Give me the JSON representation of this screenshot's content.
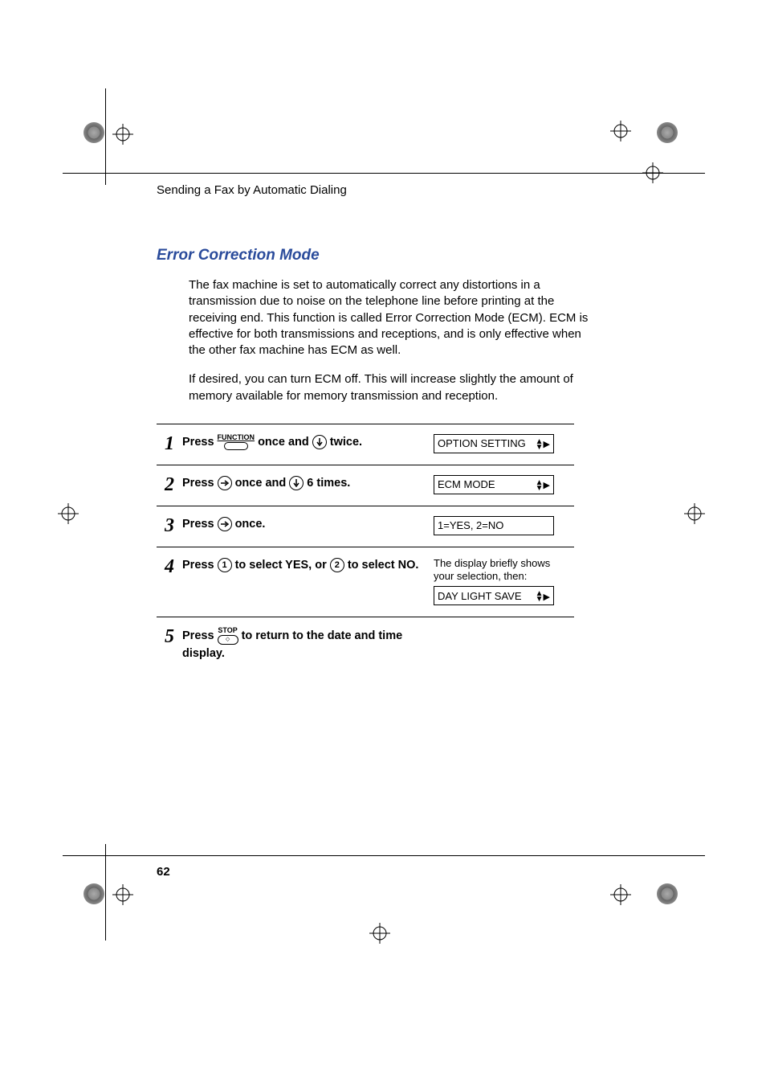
{
  "header": "Sending a Fax by Automatic Dialing",
  "section_title": "Error Correction Mode",
  "para1": "The fax machine is set to automatically correct any distortions in a transmission due to noise on the telephone line before printing at the receiving end. This function is called Error Correction Mode (ECM). ECM is effective for both transmissions and receptions, and is only effective when the other fax machine has ECM as well.",
  "para2": "If desired, you can turn ECM off. This will increase slightly the amount of memory available for memory transmission and reception.",
  "key_labels": {
    "function": "FUNCTION",
    "stop": "STOP"
  },
  "steps": [
    {
      "num": "1",
      "t1": "Press",
      "t2": "once and",
      "t3": "twice.",
      "display": "OPTION SETTING",
      "arrows": true
    },
    {
      "num": "2",
      "t1": "Press",
      "t2": "once and",
      "t3": "6 times.",
      "display": "ECM MODE",
      "arrows": true
    },
    {
      "num": "3",
      "t1": "Press",
      "t2": "once.",
      "display": "1=YES, 2=NO",
      "arrows": false
    },
    {
      "num": "4",
      "t1": "Press",
      "t2": "to select YES, or",
      "t3": "to select NO.",
      "key_a": "1",
      "key_b": "2",
      "note": "The display briefly shows your selection, then:",
      "display": "DAY LIGHT SAVE",
      "arrows": true
    },
    {
      "num": "5",
      "t1": "Press",
      "t2": "to return to the date and time display."
    }
  ],
  "page_number": "62"
}
